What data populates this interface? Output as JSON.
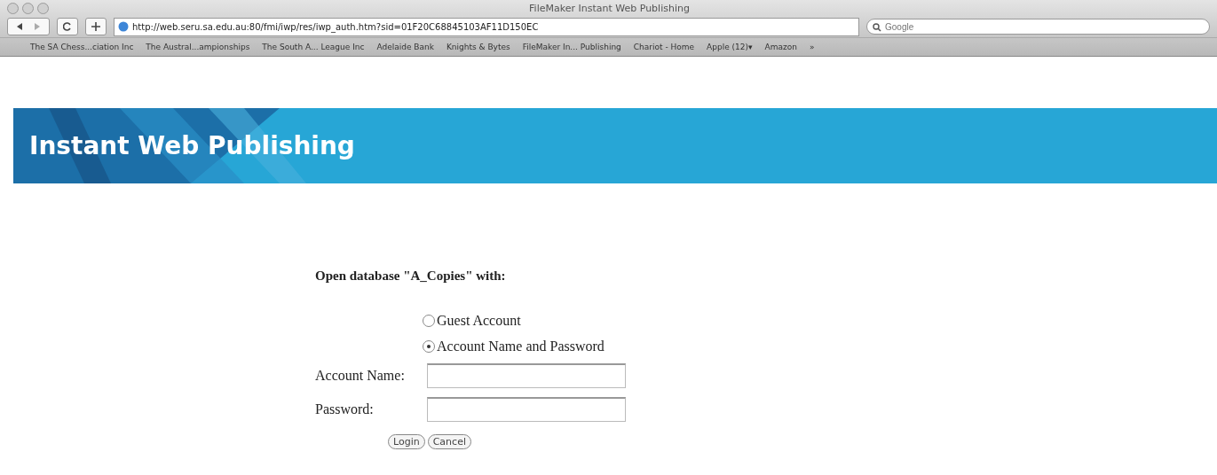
{
  "window": {
    "title": "FileMaker Instant Web Publishing"
  },
  "toolbar": {
    "url": "http://web.seru.sa.edu.au:80/fmi/iwp/res/iwp_auth.htm?sid=01F20C68845103AF11D150EC",
    "search": {
      "placeholder": "Google"
    }
  },
  "bookmarks": [
    "The SA Chess...ciation Inc",
    "The Austral...ampionships",
    "The South A... League Inc",
    "Adelaide Bank",
    "Knights & Bytes",
    "FileMaker In... Publishing",
    "Chariot - Home",
    "Apple (12)▾",
    "Amazon"
  ],
  "overflow": "»",
  "banner": {
    "title": "Instant Web Publishing"
  },
  "form": {
    "heading": "Open database \"A_Copies\" with:",
    "options": [
      {
        "label": "Guest Account",
        "selected": false
      },
      {
        "label": "Account Name and Password",
        "selected": true
      }
    ],
    "fields": [
      {
        "label": "Account Name:"
      },
      {
        "label": "Password:"
      }
    ],
    "buttons": [
      "Login",
      "Cancel"
    ]
  }
}
